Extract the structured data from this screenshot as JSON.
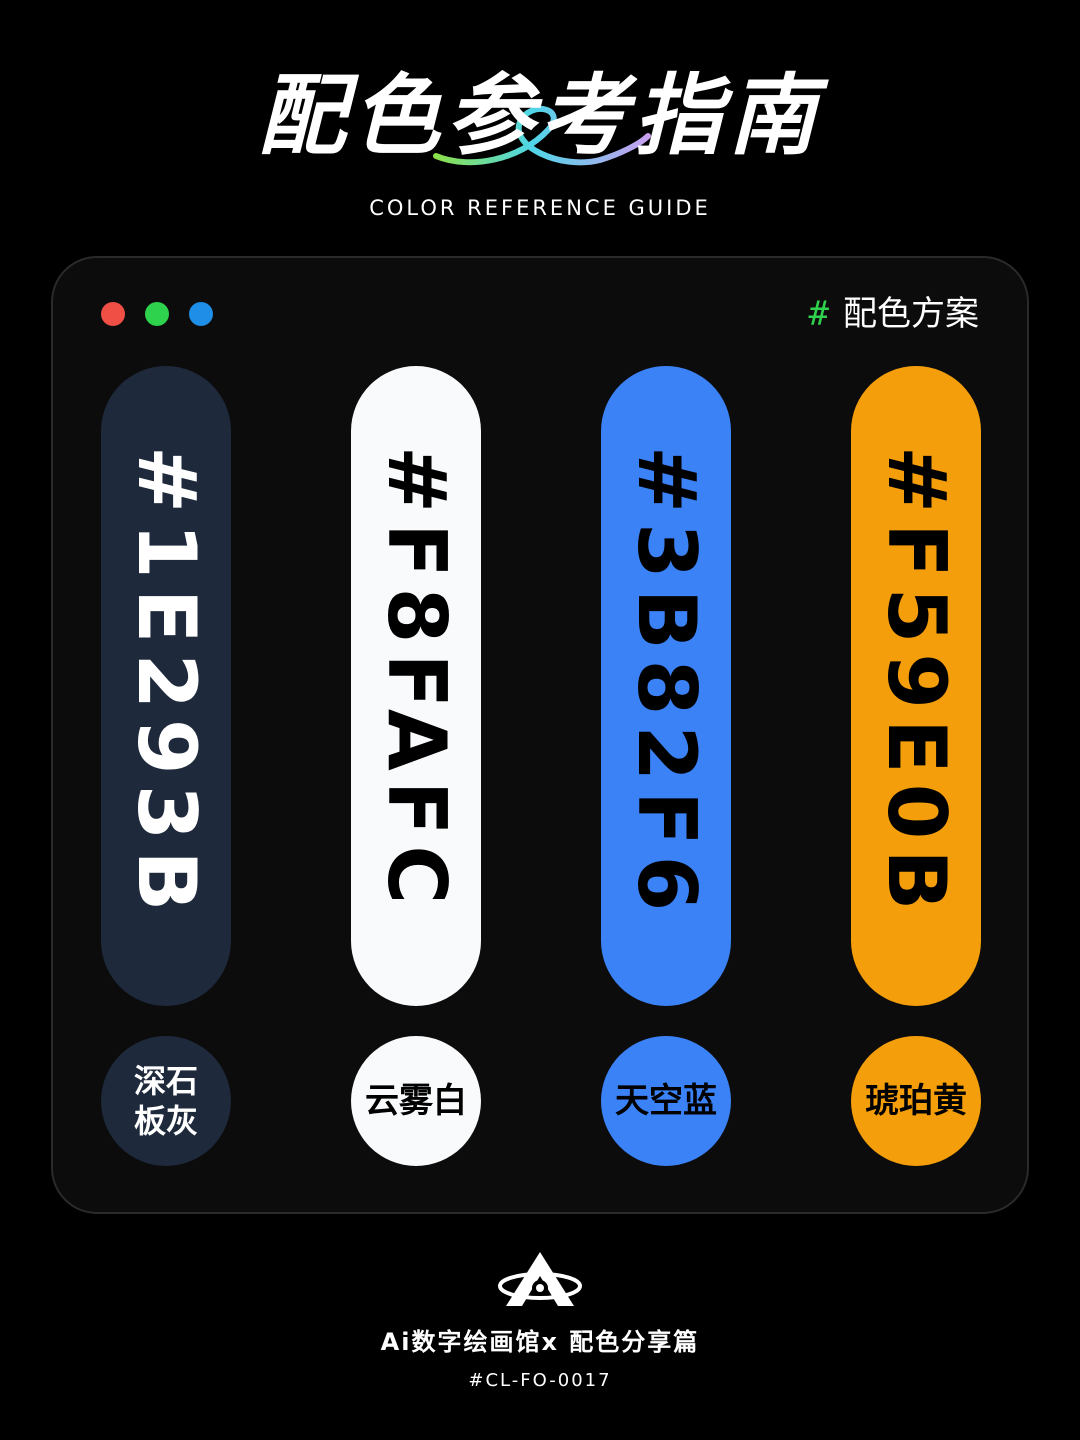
{
  "header": {
    "title": "配色参考指南",
    "subtitle": "COLOR REFERENCE GUIDE"
  },
  "window": {
    "dots": [
      {
        "name": "red",
        "color": "#EF4F45"
      },
      {
        "name": "green",
        "color": "#2ED24D"
      },
      {
        "name": "blue",
        "color": "#1E8EE6"
      }
    ],
    "scheme_hash": "#",
    "scheme_hash_color": "#2ED24D",
    "scheme_label": "配色方案"
  },
  "swatches": [
    {
      "hex": "#1E293B",
      "name": "深石板灰",
      "color": "#1E293B",
      "text_color": "#FFFFFF"
    },
    {
      "hex": "#F8FAFC",
      "name": "云雾白",
      "color": "#F8FAFC",
      "text_color": "#000000"
    },
    {
      "hex": "#3B82F6",
      "name": "天空蓝",
      "color": "#3B82F6",
      "text_color": "#000000"
    },
    {
      "hex": "#F59E0B",
      "name": "琥珀黄",
      "color": "#F59E0B",
      "text_color": "#000000"
    }
  ],
  "footer": {
    "logo_icon": "a-ring-logo-icon",
    "title": "Ai数字绘画馆x 配色分享篇",
    "code": "#CL-FO-0017"
  }
}
